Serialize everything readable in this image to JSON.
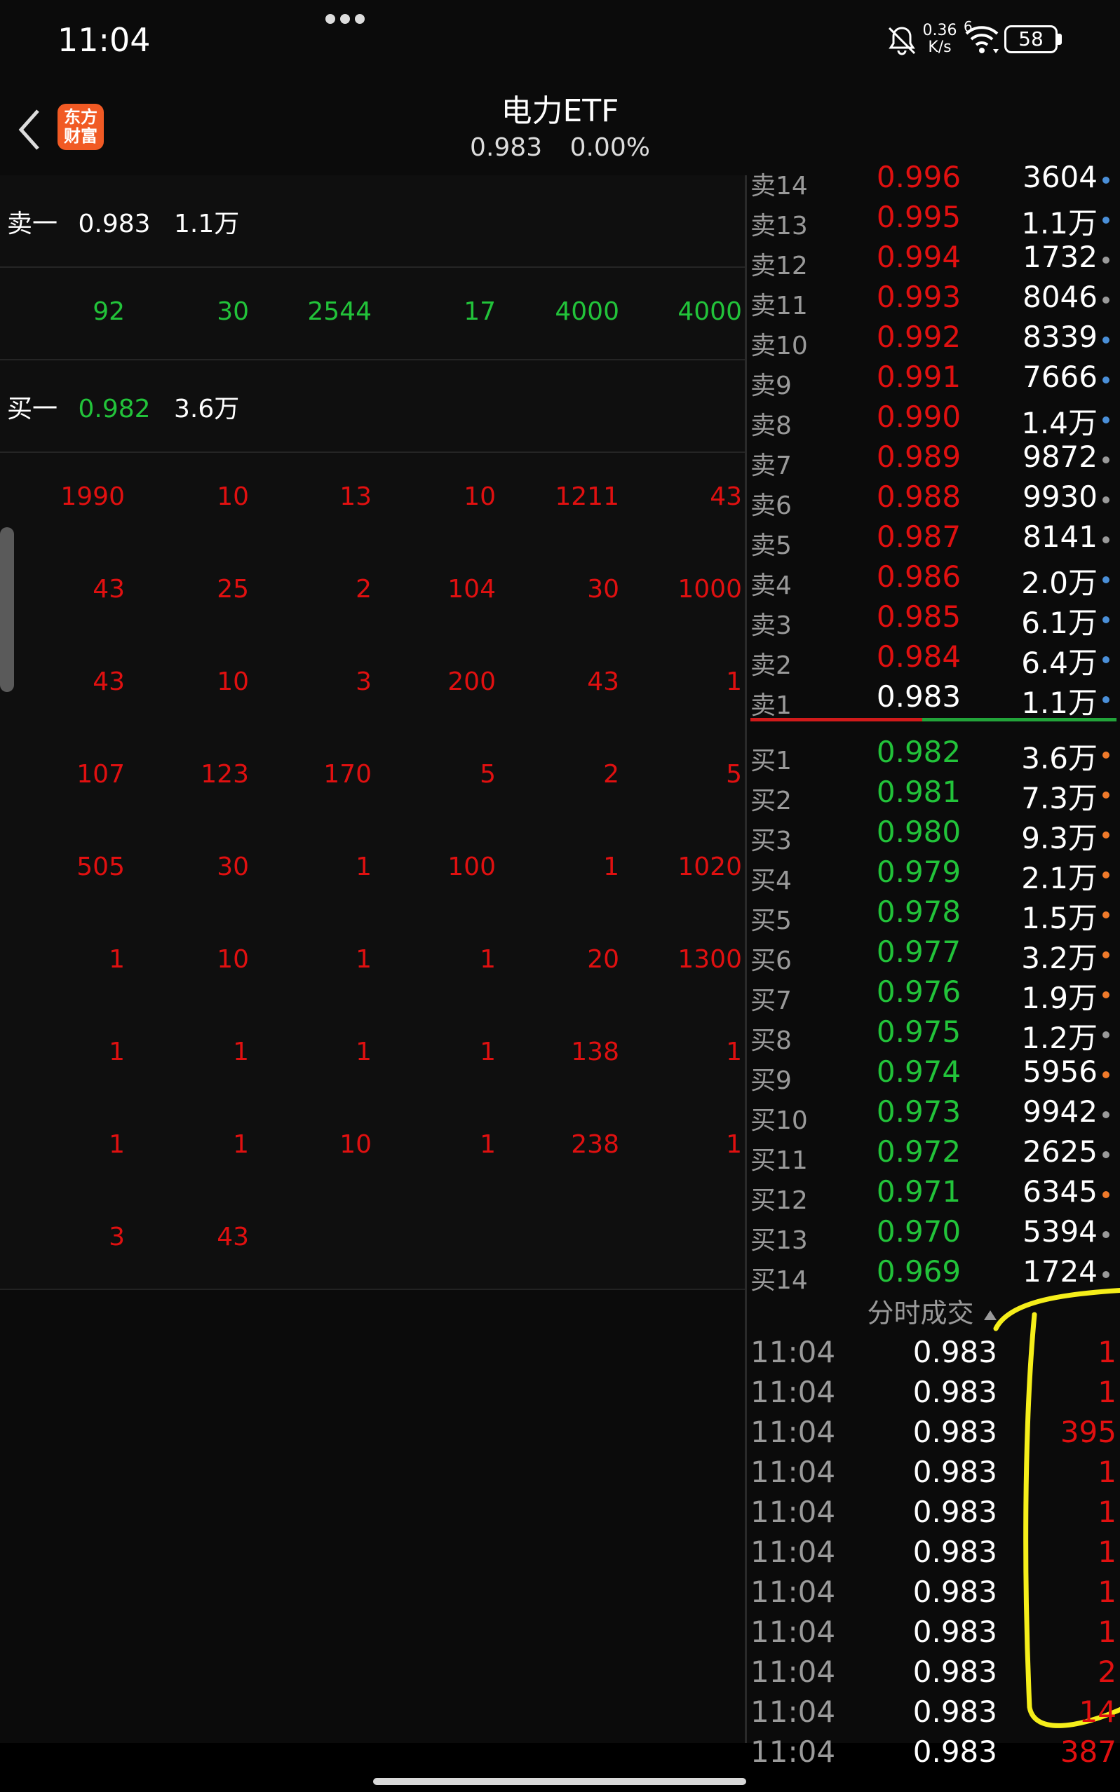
{
  "status_bar": {
    "time": "11:04",
    "net_speed_value": "0.36",
    "net_speed_unit": "K/s",
    "signal_badge": "6",
    "battery": "58"
  },
  "header": {
    "back_icon": "chevron-left-icon",
    "logo_line1": "东方",
    "logo_line2": "财富",
    "title": "电力ETF",
    "price": "0.983",
    "change_pct": "0.00%"
  },
  "left_panel": {
    "ask_label": "卖一",
    "ask_price": "0.983",
    "ask_volume": "1.1万",
    "ask_queue": [
      "92",
      "30",
      "2544",
      "17",
      "4000",
      "4000"
    ],
    "bid_label": "买一",
    "bid_price": "0.982",
    "bid_volume": "3.6万",
    "bid_queue": [
      [
        "1990",
        "10",
        "13",
        "10",
        "1211",
        "43"
      ],
      [
        "43",
        "25",
        "2",
        "104",
        "30",
        "1000"
      ],
      [
        "43",
        "10",
        "3",
        "200",
        "43",
        "1"
      ],
      [
        "107",
        "123",
        "170",
        "5",
        "2",
        "5"
      ],
      [
        "505",
        "30",
        "1",
        "100",
        "1",
        "1020"
      ],
      [
        "1",
        "10",
        "1",
        "1",
        "20",
        "1300"
      ],
      [
        "1",
        "1",
        "1",
        "1",
        "138",
        "1"
      ],
      [
        "1",
        "1",
        "10",
        "1",
        "238",
        "1"
      ],
      [
        "3",
        "43",
        "",
        "",
        "",
        ""
      ]
    ]
  },
  "order_book": {
    "asks": [
      {
        "label": "卖14",
        "price": "0.996",
        "volume": "3604",
        "dot": "#4a8fd8"
      },
      {
        "label": "卖13",
        "price": "0.995",
        "volume": "1.1万",
        "dot": "#4a8fd8"
      },
      {
        "label": "卖12",
        "price": "0.994",
        "volume": "1732",
        "dot": "#9a9a9a"
      },
      {
        "label": "卖11",
        "price": "0.993",
        "volume": "8046",
        "dot": "#9a9a9a"
      },
      {
        "label": "卖10",
        "price": "0.992",
        "volume": "8339",
        "dot": "#4a8fd8"
      },
      {
        "label": "卖9",
        "price": "0.991",
        "volume": "7666",
        "dot": "#4a8fd8"
      },
      {
        "label": "卖8",
        "price": "0.990",
        "volume": "1.4万",
        "dot": "#4a8fd8"
      },
      {
        "label": "卖7",
        "price": "0.989",
        "volume": "9872",
        "dot": "#9a9a9a"
      },
      {
        "label": "卖6",
        "price": "0.988",
        "volume": "9930",
        "dot": "#9a9a9a"
      },
      {
        "label": "卖5",
        "price": "0.987",
        "volume": "8141",
        "dot": "#9a9a9a"
      },
      {
        "label": "卖4",
        "price": "0.986",
        "volume": "2.0万",
        "dot": "#4a8fd8"
      },
      {
        "label": "卖3",
        "price": "0.985",
        "volume": "6.1万",
        "dot": "#4a8fd8"
      },
      {
        "label": "卖2",
        "price": "0.984",
        "volume": "6.4万",
        "dot": "#4a8fd8"
      },
      {
        "label": "卖1",
        "price": "0.983",
        "volume": "1.1万",
        "dot": "#4a8fd8"
      }
    ],
    "bids": [
      {
        "label": "买1",
        "price": "0.982",
        "volume": "3.6万",
        "dot": "#f07a2a"
      },
      {
        "label": "买2",
        "price": "0.981",
        "volume": "7.3万",
        "dot": "#f07a2a"
      },
      {
        "label": "买3",
        "price": "0.980",
        "volume": "9.3万",
        "dot": "#f07a2a"
      },
      {
        "label": "买4",
        "price": "0.979",
        "volume": "2.1万",
        "dot": "#f07a2a"
      },
      {
        "label": "买5",
        "price": "0.978",
        "volume": "1.5万",
        "dot": "#f07a2a"
      },
      {
        "label": "买6",
        "price": "0.977",
        "volume": "3.2万",
        "dot": "#f07a2a"
      },
      {
        "label": "买7",
        "price": "0.976",
        "volume": "1.9万",
        "dot": "#f07a2a"
      },
      {
        "label": "买8",
        "price": "0.975",
        "volume": "1.2万",
        "dot": "#9a9a9a"
      },
      {
        "label": "买9",
        "price": "0.974",
        "volume": "5956",
        "dot": "#f07a2a"
      },
      {
        "label": "买10",
        "price": "0.973",
        "volume": "9942",
        "dot": "#9a9a9a"
      },
      {
        "label": "买11",
        "price": "0.972",
        "volume": "2625",
        "dot": "#9a9a9a"
      },
      {
        "label": "买12",
        "price": "0.971",
        "volume": "6345",
        "dot": "#f07a2a"
      },
      {
        "label": "买13",
        "price": "0.970",
        "volume": "5394",
        "dot": "#9a9a9a"
      },
      {
        "label": "买14",
        "price": "0.969",
        "volume": "1724",
        "dot": "#9a9a9a"
      }
    ]
  },
  "ticks": {
    "header": "分时成交",
    "sort_icon": "triangle-up-icon",
    "rows": [
      {
        "time": "11:04",
        "price": "0.983",
        "volume": "1"
      },
      {
        "time": "11:04",
        "price": "0.983",
        "volume": "1"
      },
      {
        "time": "11:04",
        "price": "0.983",
        "volume": "395"
      },
      {
        "time": "11:04",
        "price": "0.983",
        "volume": "1"
      },
      {
        "time": "11:04",
        "price": "0.983",
        "volume": "1"
      },
      {
        "time": "11:04",
        "price": "0.983",
        "volume": "1"
      },
      {
        "time": "11:04",
        "price": "0.983",
        "volume": "1"
      },
      {
        "time": "11:04",
        "price": "0.983",
        "volume": "1"
      },
      {
        "time": "11:04",
        "price": "0.983",
        "volume": "2"
      },
      {
        "time": "11:04",
        "price": "0.983",
        "volume": "14"
      },
      {
        "time": "11:04",
        "price": "0.983",
        "volume": "387"
      }
    ]
  },
  "colors": {
    "up": "#e01010",
    "down": "#22c33a",
    "highlight": "#f5ee1a"
  }
}
